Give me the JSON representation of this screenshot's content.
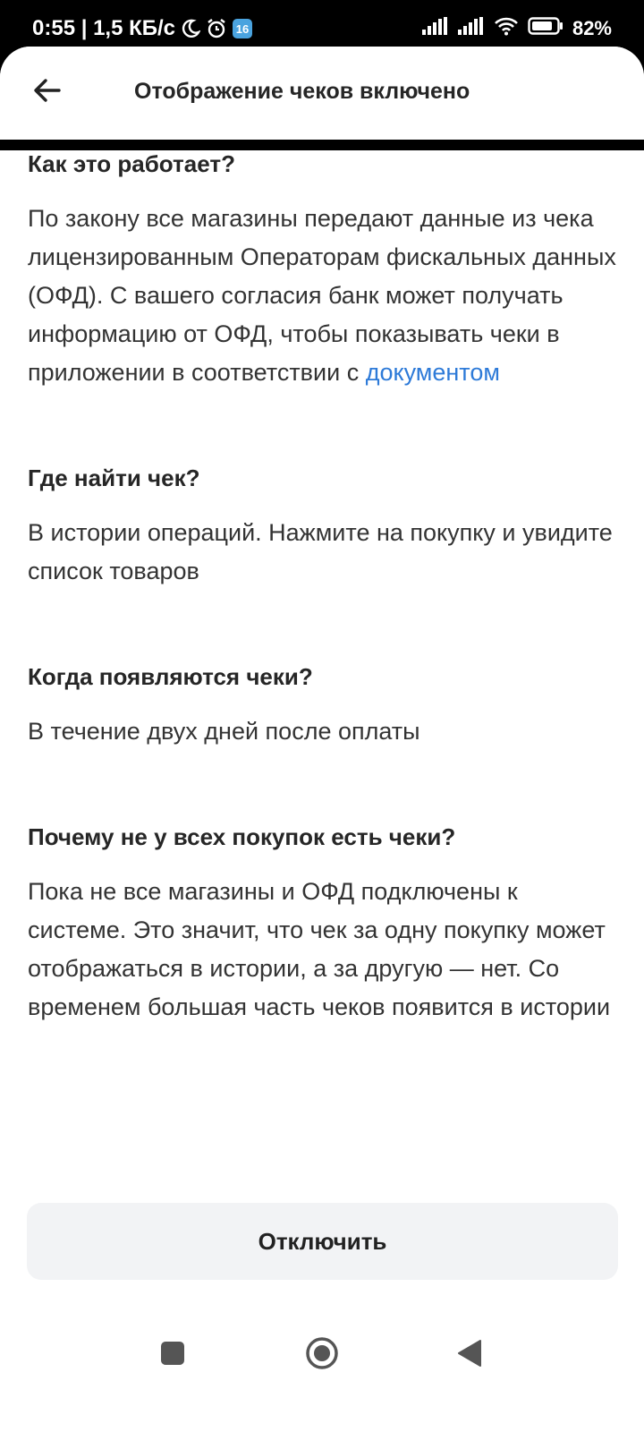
{
  "status_bar": {
    "time_speed": "0:55 | 1,5 КБ/с",
    "notification_badge": "16",
    "battery": "82%"
  },
  "header": {
    "title": "Отображение чеков включено"
  },
  "sections": [
    {
      "title": "Как это работает?",
      "text": "По закону все магазины передают данные из чека лицензированным Операторам фискальных данных (ОФД). С вашего согласия банк может получать информацию от ОФД, чтобы показывать чеки в приложении в соответствии с ",
      "link": "документом"
    },
    {
      "title": "Где найти чек?",
      "text": "В истории операций. Нажмите на покупку и увидите список товаров"
    },
    {
      "title": "Когда появляются чеки?",
      "text": "В течение двух дней после оплаты"
    },
    {
      "title": "Почему не у всех покупок есть чеки?",
      "text": "Пока не все магазины и ОФД подключены к системе. Это значит, что чек за одну покупку может отображаться в истории, а за другую — нет. Со временем большая часть чеков появится в истории"
    }
  ],
  "disable_button": "Отключить",
  "icons": {
    "back": "arrow-left-icon",
    "recents": "square-icon",
    "home": "circle-icon",
    "nav_back": "triangle-back-icon"
  },
  "colors": {
    "link": "#2d7ad8",
    "button_bg": "#f2f3f5"
  }
}
